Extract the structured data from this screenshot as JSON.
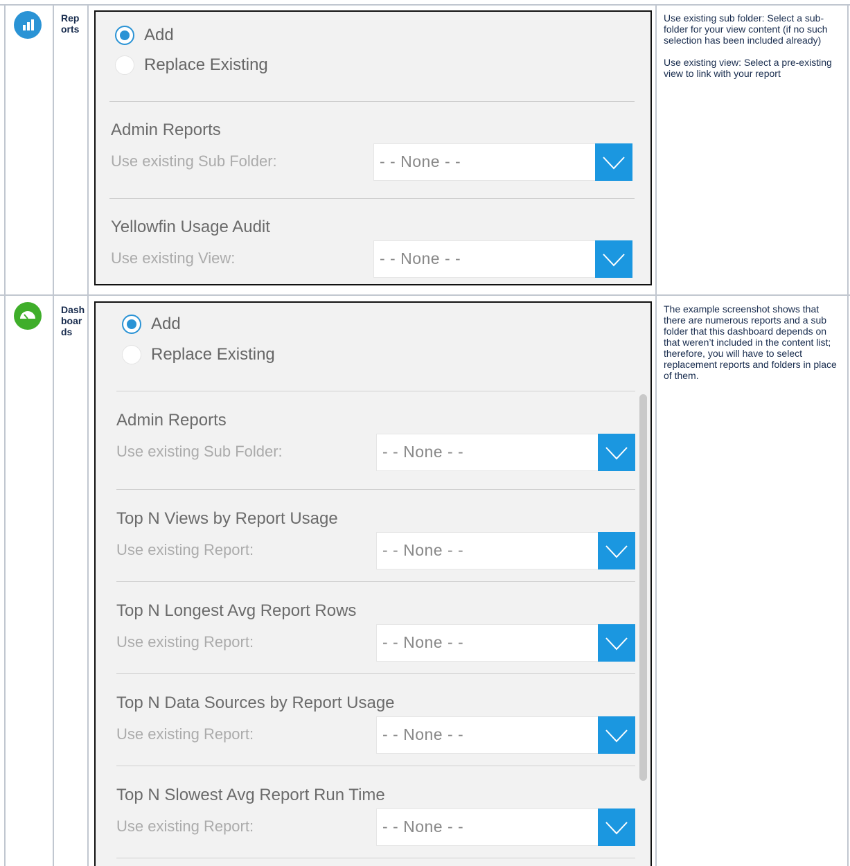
{
  "rows": {
    "reports": {
      "icon": "bar-chart-icon",
      "icon_color": "#2a93d5",
      "label": "Reports",
      "panel": {
        "radio_add": "Add",
        "radio_replace": "Replace Existing",
        "sections": [
          {
            "title": "Admin Reports",
            "sub": "Use existing Sub Folder:",
            "value": "- - None - -"
          },
          {
            "title": "Yellowfin Usage Audit",
            "sub": "Use existing View:",
            "value": "- - None - -"
          }
        ]
      },
      "notes": [
        "Use existing sub folder: Select a sub-folder for your view content (if no such selection has been included already)",
        "Use existing view: Select a pre-existing view to link with your report"
      ]
    },
    "dashboards": {
      "icon": "dashboard-gauge-icon",
      "icon_color": "#3fae2a",
      "label": "Dashboards",
      "panel": {
        "radio_add": "Add",
        "radio_replace": "Replace Existing",
        "sections": [
          {
            "title": "Admin Reports",
            "sub": "Use existing Sub Folder:",
            "value": "- - None - -"
          },
          {
            "title": "Top N Views by Report Usage",
            "sub": "Use existing Report:",
            "value": "- - None - -"
          },
          {
            "title": "Top N Longest Avg Report Rows",
            "sub": "Use existing Report:",
            "value": "- - None - -"
          },
          {
            "title": "Top N Data Sources by Report Usage",
            "sub": "Use existing Report:",
            "value": "- - None - -"
          },
          {
            "title": "Top N Slowest Avg Report Run Time",
            "sub": "Use existing Report:",
            "value": "- - None - -"
          }
        ]
      },
      "notes": [
        "The example screenshot shows that there are numerous reports and a sub folder that this dashboard depends on that weren’t included in the content list; therefore, you will have to select replacement reports and folders in place of them."
      ]
    }
  },
  "colors": {
    "accent": "#1b97e0",
    "panel_bg": "#f2f2f2",
    "grid": "#c1c7d0"
  }
}
